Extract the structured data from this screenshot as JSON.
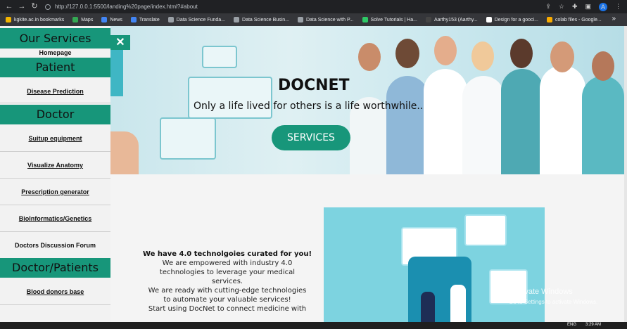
{
  "browser": {
    "url": "http://127.0.0.1:5500/landing%20page/index.html?#about",
    "avatar_letter": "A",
    "bookmarks": [
      {
        "label": "kgkite.ac.in bookmarks",
        "color": "#f4b400"
      },
      {
        "label": "Maps",
        "color": "#34a853"
      },
      {
        "label": "News",
        "color": "#4285f4"
      },
      {
        "label": "Translate",
        "color": "#4285f4"
      },
      {
        "label": "Data Science Funda...",
        "color": "#9aa0a6"
      },
      {
        "label": "Data Science Busin...",
        "color": "#9aa0a6"
      },
      {
        "label": "Data Science with P...",
        "color": "#9aa0a6"
      },
      {
        "label": "Solve Tutorials | Ha...",
        "color": "#2ec866"
      },
      {
        "label": "Aarthy153 (Aarthy...",
        "color": "#444444"
      },
      {
        "label": "Design for a gooci...",
        "color": "#ffffff"
      },
      {
        "label": "colab files - Google...",
        "color": "#f9ab00"
      }
    ],
    "more": "»"
  },
  "sidebar": {
    "sections": [
      {
        "title": "Our Services",
        "items": [
          "Homepage"
        ]
      },
      {
        "title": "Patient",
        "items": [
          "Disease Prediction"
        ]
      },
      {
        "title": "Doctor",
        "items": [
          "Suitup equipment",
          "Visualize Anatomy",
          "Prescription generator",
          "BioInformatics/Genetics",
          "Doctors Discussion Forum"
        ]
      },
      {
        "title": "Doctor/Patients",
        "items": [
          "Blood donors base"
        ]
      }
    ],
    "close_glyph": "✕"
  },
  "hero": {
    "title": "DOCNET",
    "tagline": "Only a life lived for others is a life worthwhile..",
    "button": "SERVICES"
  },
  "about": {
    "heading": "We have 4.0 technolgoies curated for you!",
    "lines": [
      "We are empowered with industry 4.0",
      "technologies to leverage your medical",
      "services.",
      "We are ready with cutting-edge technologies",
      "to automate your valuable services!",
      "Start using DocNet to connect medicine with"
    ]
  },
  "watermark": {
    "line1": "Activate Windows",
    "line2": "Go to Settings to activate Windows."
  },
  "taskbar": {
    "lang": "ENG",
    "time": "3:29 AM"
  },
  "colors": {
    "accent": "#17967a",
    "chrome": "#202124"
  }
}
